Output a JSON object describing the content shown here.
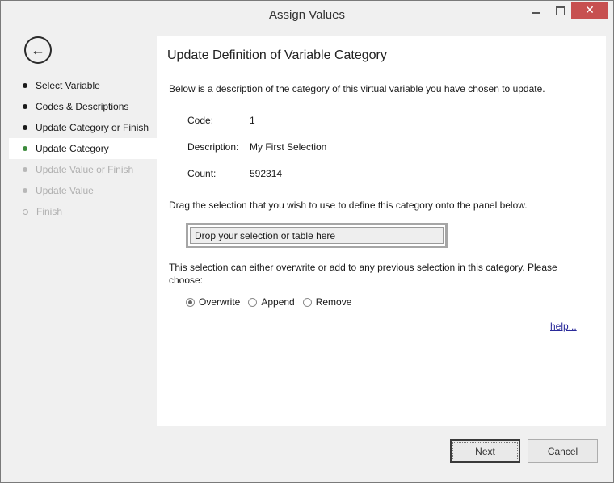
{
  "window": {
    "title": "Assign Values",
    "minimize_icon": "minimize-icon",
    "maximize_icon": "maximize-icon",
    "close_icon": "close-icon",
    "close_color": "#c75050"
  },
  "sidebar": {
    "back_icon": "back-arrow-icon",
    "steps": [
      {
        "label": "Select Variable",
        "state": "done"
      },
      {
        "label": "Codes & Descriptions",
        "state": "done"
      },
      {
        "label": "Update Category or Finish",
        "state": "done"
      },
      {
        "label": "Update Category",
        "state": "active"
      },
      {
        "label": "Update Value or Finish",
        "state": "disabled"
      },
      {
        "label": "Update Value",
        "state": "disabled"
      },
      {
        "label": "Finish",
        "state": "disabled"
      }
    ],
    "active_color": "#3c8b3c"
  },
  "main": {
    "heading": "Update Definition of Variable Category",
    "description": "Below is a description of the category of this virtual variable you have chosen to update.",
    "code_label": "Code:",
    "code_value": "1",
    "description_label": "Description:",
    "description_value": "My First Selection",
    "count_label": "Count:",
    "count_value": "592314",
    "drag_instruction": "Drag the selection that you wish to use to define this category onto the panel below.",
    "drop_zone_text": "Drop your selection or table here",
    "choose_text": "This selection can either overwrite or add to any previous selection in this category. Please choose:",
    "radio_options": [
      {
        "label": "Overwrite",
        "checked": true
      },
      {
        "label": "Append",
        "checked": false
      },
      {
        "label": "Remove",
        "checked": false
      }
    ],
    "help_link": "help..."
  },
  "footer": {
    "next_label": "Next",
    "cancel_label": "Cancel"
  }
}
